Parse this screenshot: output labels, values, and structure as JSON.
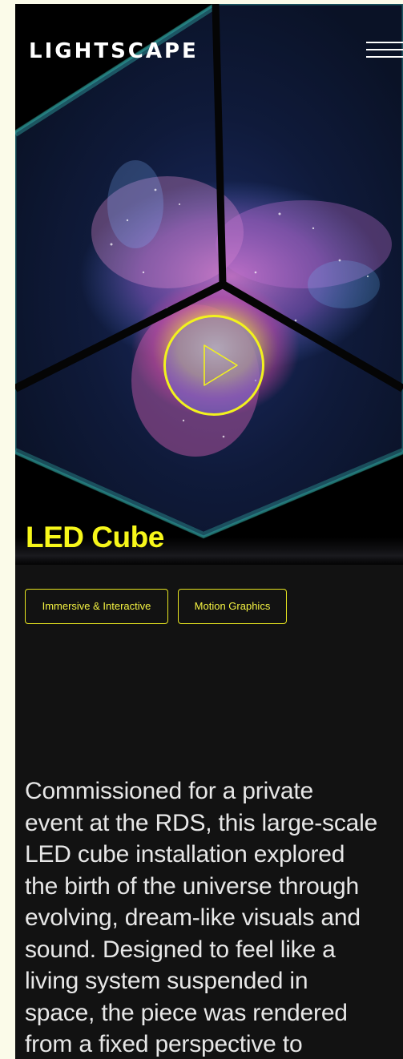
{
  "header": {
    "logo": "LIGHTSCAPE"
  },
  "project": {
    "title": "LED Cube",
    "tags": [
      "Immersive & Interactive",
      "Motion Graphics"
    ],
    "description_lines": [
      "Commissioned for a private",
      "event at the RDS, this large-scale",
      "LED cube installation explored",
      "the birth of the universe through",
      "evolving, dream-like visuals and",
      "sound. Designed to feel like a",
      "living system suspended in",
      "space, the piece was rendered",
      "from a fixed perspective to"
    ]
  },
  "colors": {
    "accent": "#f2f21e",
    "background": "#121212",
    "page_border": "#fbfbe9",
    "text": "#e7e7e7"
  },
  "icons": {
    "menu": "hamburger-menu-icon",
    "play": "play-icon"
  }
}
